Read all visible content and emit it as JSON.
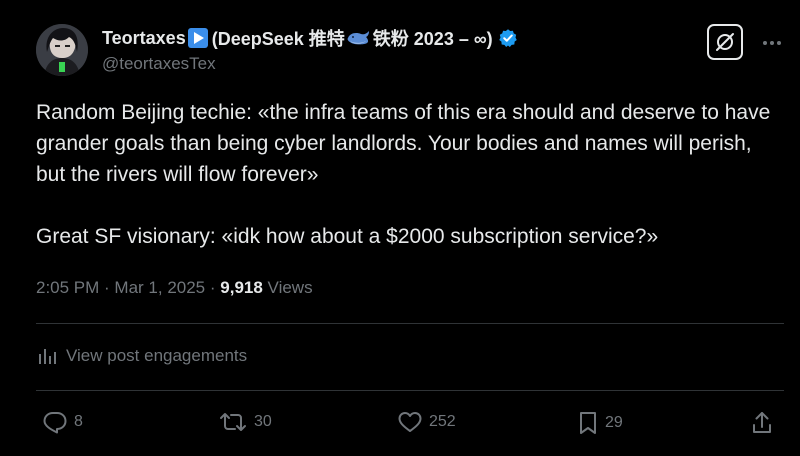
{
  "author": {
    "name": "Teortaxes",
    "name_suffix": "(DeepSeek 推特",
    "name_tail": "铁粉 2023 – ∞)",
    "handle": "@teortaxesTex"
  },
  "post": {
    "paragraph_1": "Random Beijing techie: «the infra teams of this era should and deserve to have grander goals than being cyber landlords. Your bodies and names will perish, but the rivers will flow forever»",
    "paragraph_2": "Great SF visionary: «idk how about a $2000 subscription service?»",
    "time": "2:05 PM",
    "date": "Mar 1, 2025",
    "views_count": "9,918",
    "views_label": "Views"
  },
  "engagements_label": "View post engagements",
  "actions": {
    "replies": "8",
    "reposts": "30",
    "likes": "252",
    "bookmarks": "29"
  },
  "colors": {
    "background": "#000000",
    "text": "#e7e9ea",
    "secondary": "#71767b",
    "divider": "#2f3336",
    "verified": "#1d9bf0"
  },
  "icons": {
    "grok": "grok-icon",
    "more": "more-icon",
    "engagements": "bar-chart-icon",
    "reply": "reply-icon",
    "repost": "repost-icon",
    "like": "heart-icon",
    "bookmark": "bookmark-icon",
    "share": "share-icon"
  }
}
